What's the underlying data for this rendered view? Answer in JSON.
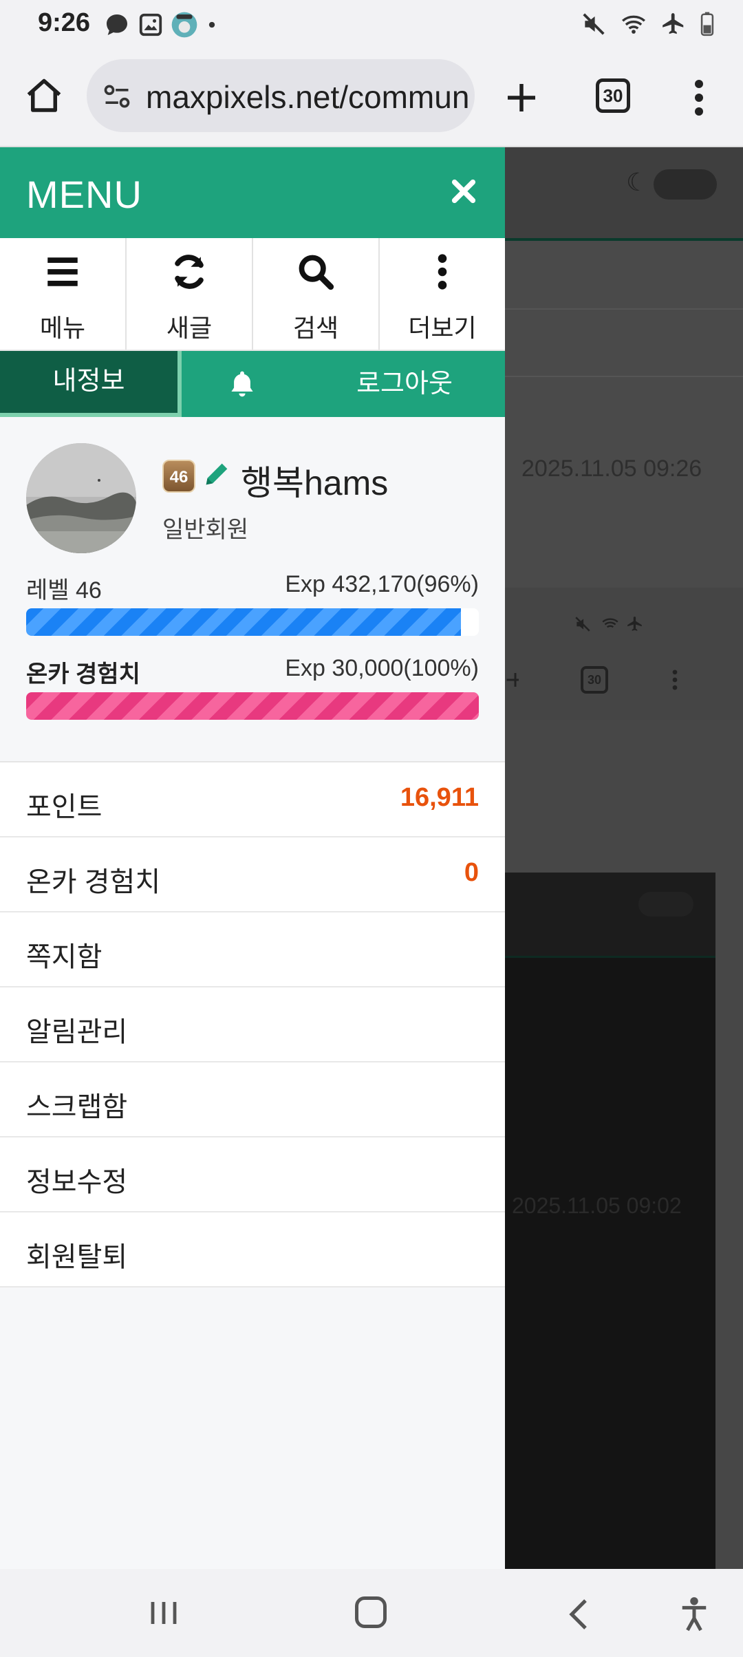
{
  "status_bar": {
    "time": "9:26"
  },
  "browser": {
    "url": "maxpixels.net/commun",
    "tab_count": "30"
  },
  "background_page": {
    "date_1": "2025.11.05 09:26",
    "date_2": "2025.11.05 09:02",
    "inner_tab_count": "30"
  },
  "menu": {
    "title": "MENU",
    "quick": [
      {
        "label": "메뉴",
        "icon": "menu-icon"
      },
      {
        "label": "새글",
        "icon": "refresh-icon"
      },
      {
        "label": "검색",
        "icon": "search-icon"
      },
      {
        "label": "더보기",
        "icon": "more-vertical-icon"
      }
    ],
    "tabs": {
      "my_info": "내정보",
      "logout": "로그아웃"
    },
    "profile": {
      "level_badge": "46",
      "nickname": "행복hams",
      "grade": "일반회원",
      "level_label": "레벨 46",
      "level_exp": "Exp 432,170(96%)",
      "level_progress": 0.96,
      "onka_label": "온카 경험치",
      "onka_exp": "Exp 30,000(100%)",
      "onka_progress": 1.0
    },
    "items": [
      {
        "label": "포인트",
        "value": "16,911"
      },
      {
        "label": "온카 경험치",
        "value": "0"
      },
      {
        "label": "쪽지함",
        "value": ""
      },
      {
        "label": "알림관리",
        "value": ""
      },
      {
        "label": "스크랩함",
        "value": ""
      },
      {
        "label": "정보수정",
        "value": ""
      },
      {
        "label": "회원탈퇴",
        "value": ""
      }
    ]
  },
  "colors": {
    "primary_green": "#1ea37d",
    "dark_green": "#0f5e45",
    "accent_orange": "#e8520c",
    "blue_bar": "#1a82f5",
    "pink_bar": "#e8397f"
  }
}
